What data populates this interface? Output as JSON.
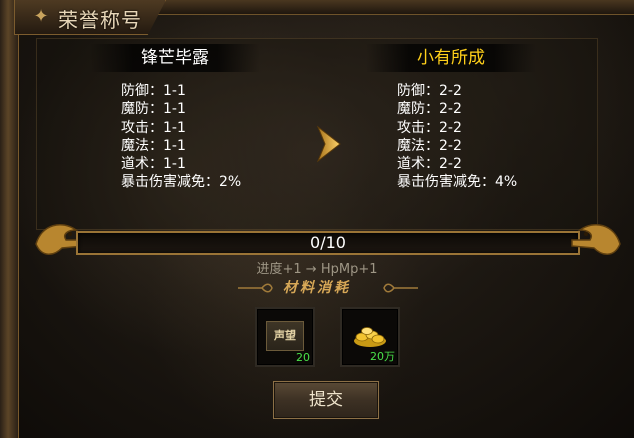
{
  "window": {
    "title": "荣誉称号"
  },
  "current": {
    "name": "锋芒毕露",
    "stats": [
      "防御：1-1",
      "魔防：1-1",
      "攻击：1-1",
      "魔法：1-1",
      "道术：1-1",
      "暴击伤害减免：2%"
    ]
  },
  "next": {
    "name": "小有所成",
    "stats": [
      "防御：2-2",
      "魔防：2-2",
      "攻击：2-2",
      "魔法：2-2",
      "道术：2-2",
      "暴击伤害减免：4%"
    ]
  },
  "progress": {
    "text": "0/10",
    "current": 0,
    "max": 10,
    "hint": "进度+1 → HpMp+1"
  },
  "materials": {
    "title": "材料消耗",
    "items": [
      {
        "icon": "reputation-icon",
        "label": "声望",
        "count": "20"
      },
      {
        "icon": "gold-coins-icon",
        "count": "20万"
      }
    ]
  },
  "actions": {
    "submit_label": "提交"
  },
  "colors": {
    "next_name": "#ffd01a",
    "count": "#49e049",
    "frame_gold": "#9a7436"
  }
}
